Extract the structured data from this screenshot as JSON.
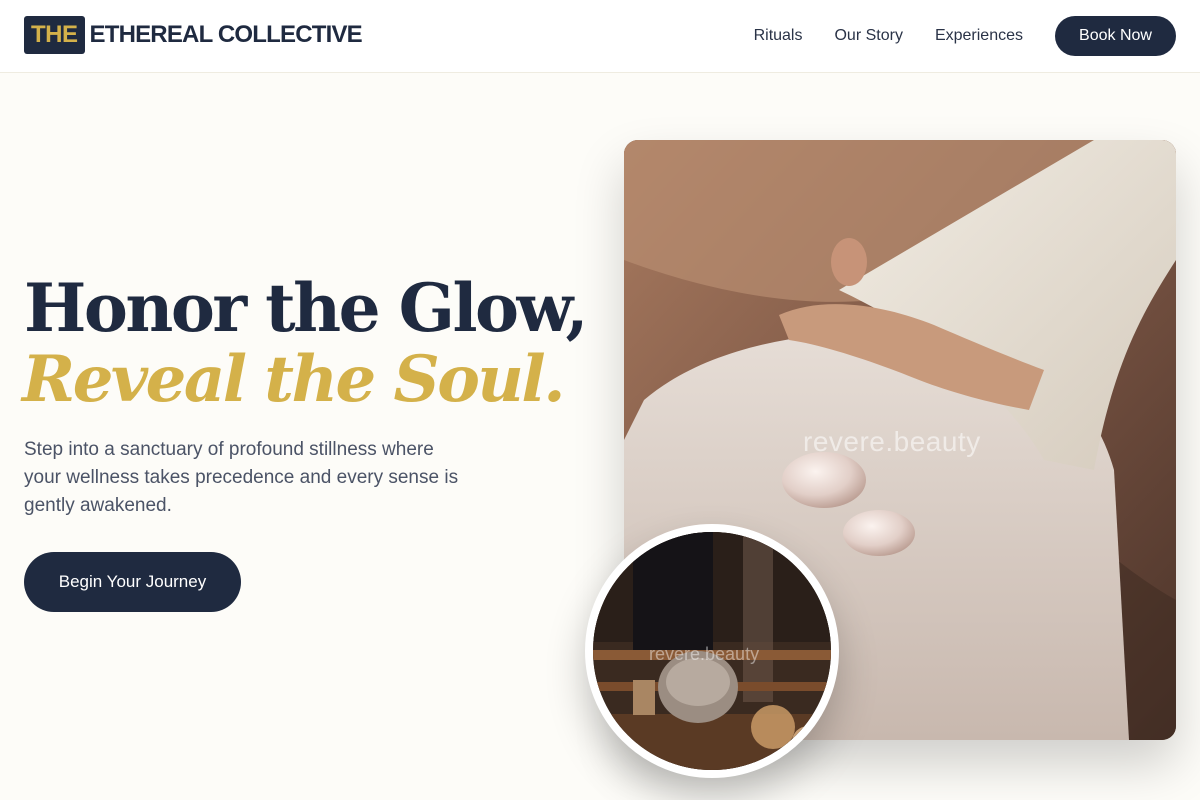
{
  "header": {
    "logo_badge": "THE",
    "logo_rest": "ETHEREAL COLLECTIVE",
    "nav": [
      "Rituals",
      "Our Story",
      "Experiences"
    ],
    "cta": "Book Now"
  },
  "hero": {
    "headline_line1": "Honor the Glow,",
    "headline_line2": "Reveal the Soul.",
    "subtitle": "Step into a sanctuary of profound stillness where your wellness takes precedence and every sense is gently awakened.",
    "cta": "Begin Your Journey"
  },
  "images": {
    "main_watermark": "revere.beauty",
    "circle_watermark": "revere.beauty"
  },
  "colors": {
    "navy": "#1f2a40",
    "gold": "#d4b14a",
    "background": "#fdfcf8"
  }
}
